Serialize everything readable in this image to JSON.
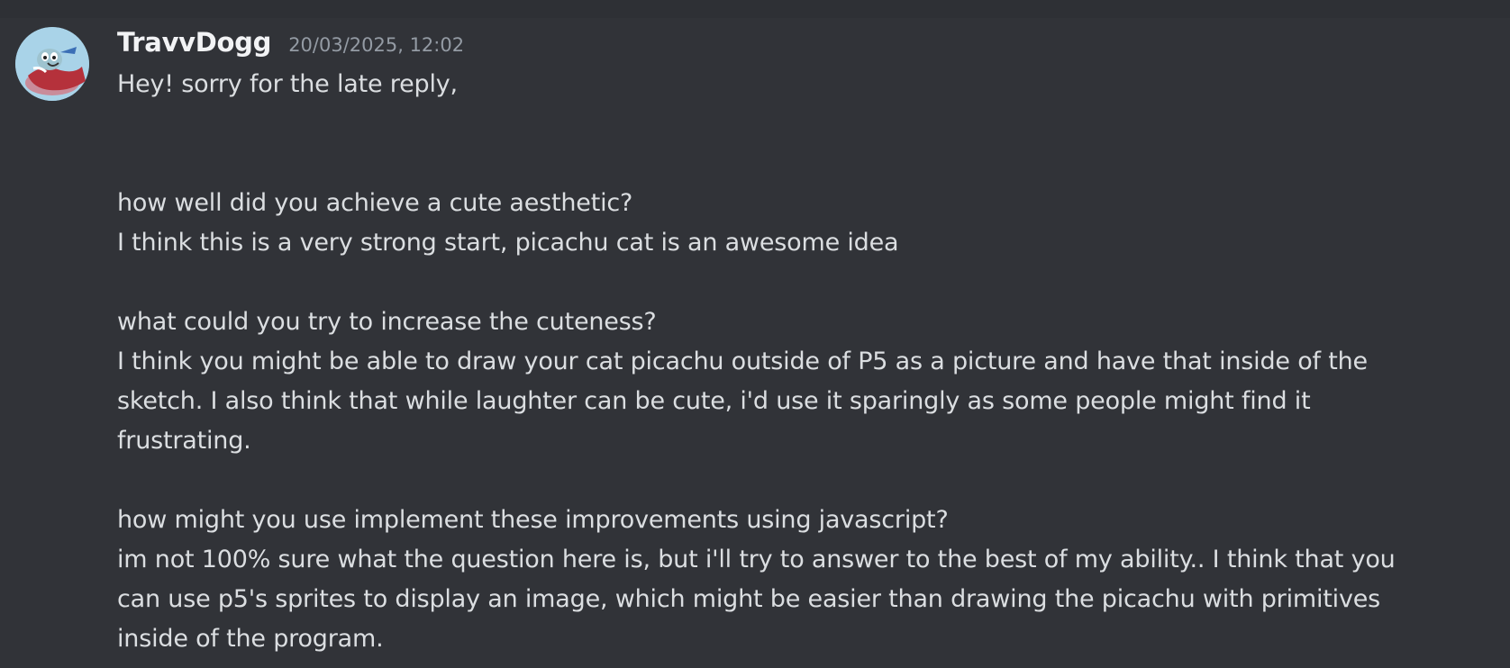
{
  "message": {
    "author": {
      "username": "TravvDogg",
      "avatar_icon": "cartoon-character-avatar"
    },
    "timestamp": "20/03/2025, 12:02",
    "lines": [
      "Hey! sorry for the late reply,",
      "",
      "",
      "how well did you achieve a cute aesthetic?",
      "I think this is a very strong start, picachu cat is an awesome idea",
      "",
      "what could you try to increase the cuteness?",
      "I think you might be able to draw your cat picachu outside of P5 as a picture and have that inside of the",
      "sketch. I also think that while laughter can be cute, i'd use it sparingly as some people might find it",
      "frustrating.",
      "",
      "how might you use implement these improvements using javascript?",
      "im not 100% sure what the question here is, but i'll try to answer to the best of my ability.. I think that you",
      "can use p5's sprites to display an image, which might be easier than drawing the picachu with primitives",
      "inside of the program."
    ]
  },
  "colors": {
    "background": "#313338",
    "username": "#f2f3f5",
    "timestamp": "#949ba4",
    "text": "#dbdee1"
  }
}
